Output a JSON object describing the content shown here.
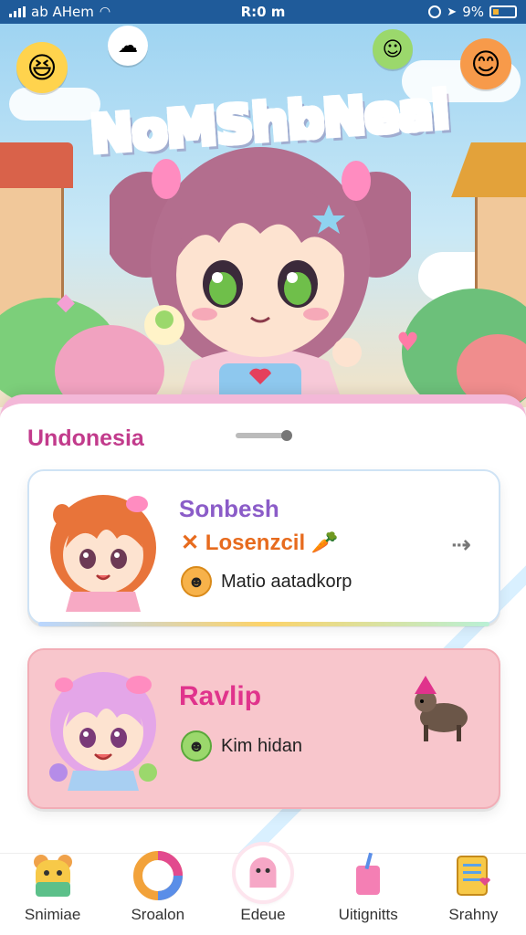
{
  "status_bar": {
    "carrier": "ab AHem",
    "time": "R:0 m",
    "battery": "9%"
  },
  "hero": {
    "brand_title": "NoMShbNeal"
  },
  "panel": {
    "region_label": "Undonesia"
  },
  "cards": [
    {
      "title": "Sonbesh",
      "subtitle": "Losenzcil",
      "meta_text": "Matio aatadkorp",
      "title_color": "#8b5cc8",
      "icon": "orange-smile-icon"
    },
    {
      "title": "Ravlip",
      "meta_text": "Kim hidan",
      "title_color": "#e0338c",
      "icon": "green-smile-icon"
    }
  ],
  "bottom_nav": {
    "items": [
      {
        "label": "Snimiae",
        "icon": "bear-icon"
      },
      {
        "label": "Sroalon",
        "icon": "ring-icon"
      },
      {
        "label": "Edeue",
        "icon": "ghost-icon",
        "active": true
      },
      {
        "label": "Uitignitts",
        "icon": "cup-icon"
      },
      {
        "label": "Srahny",
        "icon": "notebook-icon"
      }
    ]
  },
  "colors": {
    "status_bar": "#1f5b9a",
    "accent_pink": "#f3b8d8",
    "card_pink": "#f8c6cc"
  }
}
